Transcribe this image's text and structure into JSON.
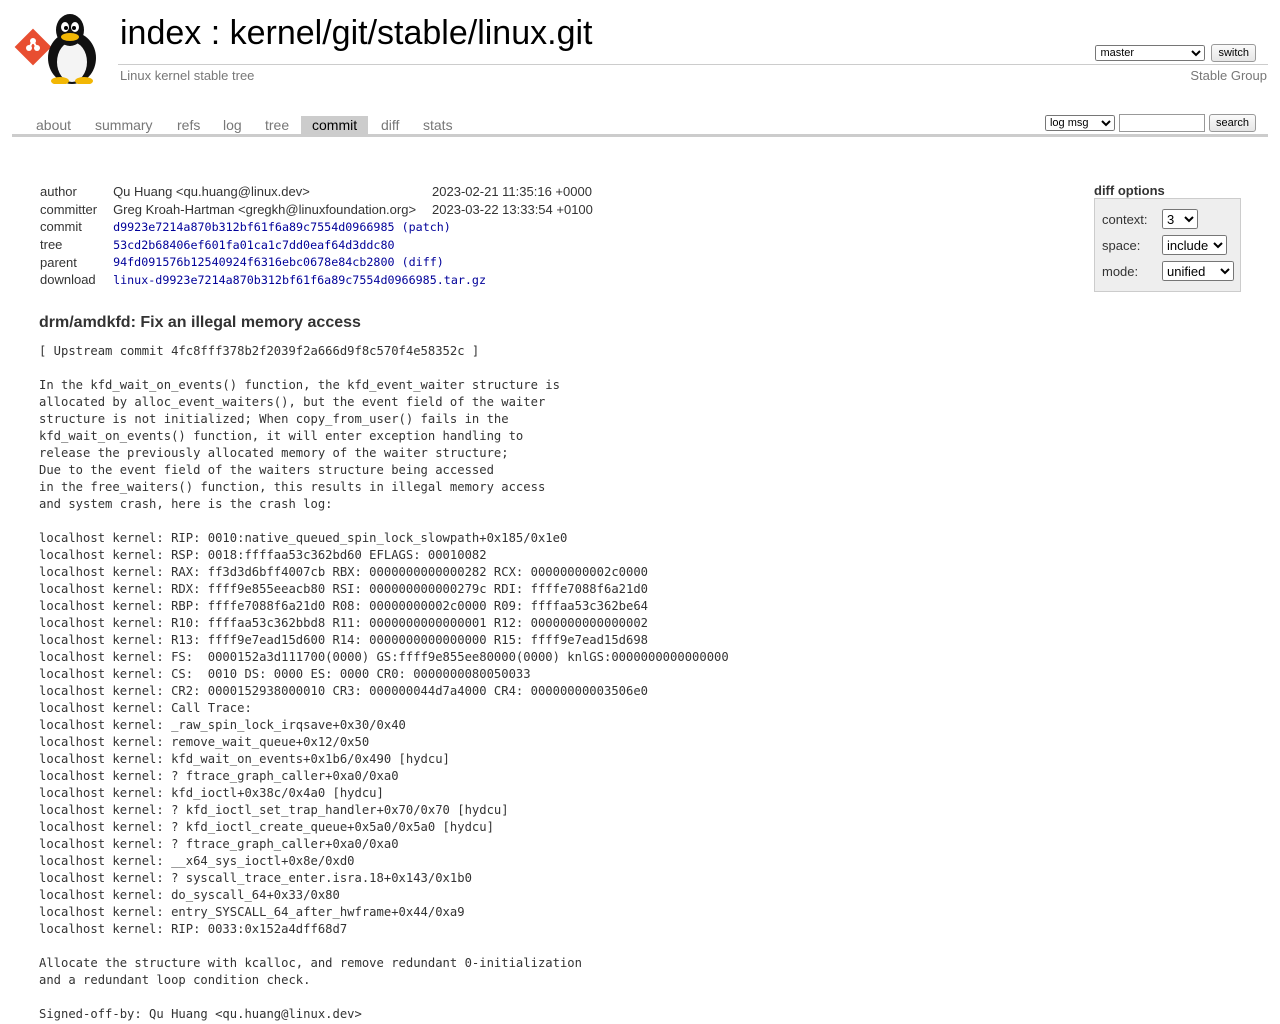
{
  "header": {
    "title_index": "index",
    "title_sep": " : ",
    "title_repo": "kernel/git/stable/linux.git",
    "description": "Linux kernel stable tree",
    "owner": "Stable Group",
    "branch_selected": "master",
    "switch_label": "switch"
  },
  "tabs": [
    {
      "label": "about"
    },
    {
      "label": "summary"
    },
    {
      "label": "refs"
    },
    {
      "label": "log"
    },
    {
      "label": "tree"
    },
    {
      "label": "commit",
      "active": true
    },
    {
      "label": "diff"
    },
    {
      "label": "stats"
    }
  ],
  "search": {
    "mode_selected": "log msg",
    "query": "",
    "button_label": "search"
  },
  "commit_info": {
    "author_label": "author",
    "author": "Qu Huang <qu.huang@linux.dev>",
    "author_date": "2023-02-21 11:35:16 +0000",
    "committer_label": "committer",
    "committer": "Greg Kroah-Hartman <gregkh@linuxfoundation.org>",
    "committer_date": "2023-03-22 13:33:54 +0100",
    "commit_label": "commit",
    "commit": "d9923e7214a870b312bf61f6a89c7554d0966985",
    "patch_link": "(patch)",
    "tree_label": "tree",
    "tree": "53cd2b68406ef601fa01ca1c7dd0eaf64d3ddc80",
    "parent_label": "parent",
    "parent": "94fd091576b12540924f6316ebc0678e84cb2800",
    "diff_link": "(diff)",
    "download_label": "download",
    "download": "linux-d9923e7214a870b312bf61f6a89c7554d0966985.tar.gz"
  },
  "diff_options": {
    "title": "diff options",
    "context_label": "context:",
    "context_value": "3",
    "space_label": "space:",
    "space_value": "include",
    "mode_label": "mode:",
    "mode_value": "unified"
  },
  "message": {
    "subject": "drm/amdkfd: Fix an illegal memory access",
    "body": "[ Upstream commit 4fc8fff378b2f2039f2a666d9f8c570f4e58352c ]\n\nIn the kfd_wait_on_events() function, the kfd_event_waiter structure is\nallocated by alloc_event_waiters(), but the event field of the waiter\nstructure is not initialized; When copy_from_user() fails in the\nkfd_wait_on_events() function, it will enter exception handling to\nrelease the previously allocated memory of the waiter structure;\nDue to the event field of the waiters structure being accessed\nin the free_waiters() function, this results in illegal memory access\nand system crash, here is the crash log:\n\nlocalhost kernel: RIP: 0010:native_queued_spin_lock_slowpath+0x185/0x1e0\nlocalhost kernel: RSP: 0018:ffffaa53c362bd60 EFLAGS: 00010082\nlocalhost kernel: RAX: ff3d3d6bff4007cb RBX: 0000000000000282 RCX: 00000000002c0000\nlocalhost kernel: RDX: ffff9e855eeacb80 RSI: 000000000000279c RDI: ffffe7088f6a21d0\nlocalhost kernel: RBP: ffffe7088f6a21d0 R08: 00000000002c0000 R09: ffffaa53c362be64\nlocalhost kernel: R10: ffffaa53c362bbd8 R11: 0000000000000001 R12: 0000000000000002\nlocalhost kernel: R13: ffff9e7ead15d600 R14: 0000000000000000 R15: ffff9e7ead15d698\nlocalhost kernel: FS:  0000152a3d111700(0000) GS:ffff9e855ee80000(0000) knlGS:0000000000000000\nlocalhost kernel: CS:  0010 DS: 0000 ES: 0000 CR0: 0000000080050033\nlocalhost kernel: CR2: 0000152938000010 CR3: 000000044d7a4000 CR4: 00000000003506e0\nlocalhost kernel: Call Trace:\nlocalhost kernel: _raw_spin_lock_irqsave+0x30/0x40\nlocalhost kernel: remove_wait_queue+0x12/0x50\nlocalhost kernel: kfd_wait_on_events+0x1b6/0x490 [hydcu]\nlocalhost kernel: ? ftrace_graph_caller+0xa0/0xa0\nlocalhost kernel: kfd_ioctl+0x38c/0x4a0 [hydcu]\nlocalhost kernel: ? kfd_ioctl_set_trap_handler+0x70/0x70 [hydcu]\nlocalhost kernel: ? kfd_ioctl_create_queue+0x5a0/0x5a0 [hydcu]\nlocalhost kernel: ? ftrace_graph_caller+0xa0/0xa0\nlocalhost kernel: __x64_sys_ioctl+0x8e/0xd0\nlocalhost kernel: ? syscall_trace_enter.isra.18+0x143/0x1b0\nlocalhost kernel: do_syscall_64+0x33/0x80\nlocalhost kernel: entry_SYSCALL_64_after_hwframe+0x44/0xa9\nlocalhost kernel: RIP: 0033:0x152a4dff68d7\n\nAllocate the structure with kcalloc, and remove redundant 0-initialization\nand a redundant loop condition check.\n\nSigned-off-by: Qu Huang <qu.huang@linux.dev>"
  }
}
